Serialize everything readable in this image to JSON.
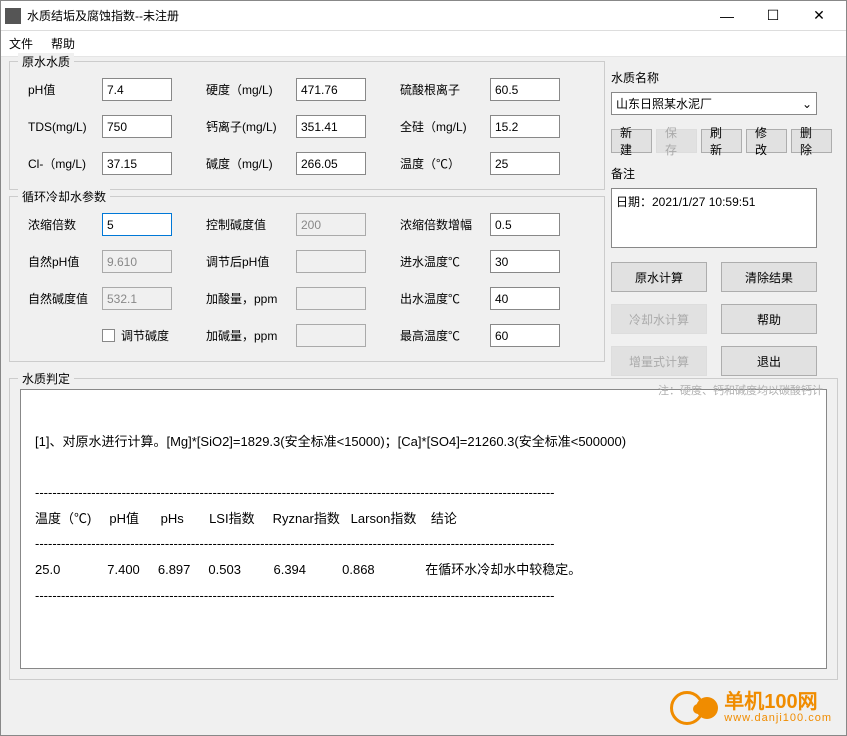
{
  "window": {
    "title": "水质结垢及腐蚀指数--未注册"
  },
  "menu": {
    "file": "文件",
    "help": "帮助"
  },
  "raw": {
    "legend": "原水水质",
    "ph_label": "pH值",
    "ph": "7.4",
    "hardness_label": "硬度（mg/L)",
    "hardness": "471.76",
    "sulfate_label": "硫酸根离子",
    "sulfate": "60.5",
    "tds_label": "TDS(mg/L)",
    "tds": "750",
    "ca_label": "钙离子(mg/L)",
    "ca": "351.41",
    "si_label": "全硅（mg/L)",
    "si": "15.2",
    "cl_label": "Cl-（mg/L)",
    "cl": "37.15",
    "alk_label": "碱度（mg/L)",
    "alk": "266.05",
    "temp_label": "温度（℃）",
    "temp": "25"
  },
  "cool": {
    "legend": "循环冷却水参数",
    "conc_label": "浓缩倍数",
    "conc": "5",
    "ctrlalk_label": "控制碱度值",
    "ctrlalk": "200",
    "concinc_label": "浓缩倍数增幅",
    "concinc": "0.5",
    "natph_label": "自然pH值",
    "natph": "9.610",
    "adjph_label": "调节后pH值",
    "adjph": "",
    "tin_label": "进水温度℃",
    "tin": "30",
    "natalk_label": "自然碱度值",
    "natalk": "532.1",
    "acid_label": "加酸量，ppm",
    "acid": "",
    "tout_label": "出水温度℃",
    "tout": "40",
    "adjalk_label": "调节碱度",
    "base_label": "加碱量，ppm",
    "base": "",
    "tmax_label": "最高温度℃",
    "tmax": "60"
  },
  "right": {
    "name_label": "水质名称",
    "name_value": "山东日照某水泥厂",
    "btn_new": "新建",
    "btn_save": "保存",
    "btn_refresh": "刷新",
    "btn_edit": "修改",
    "btn_delete": "删除",
    "remark_label": "备注",
    "remark_text": "日期：2021/1/27 10:59:51",
    "btn_rawcalc": "原水计算",
    "btn_clear": "清除结果",
    "btn_coolcalc": "冷却水计算",
    "btn_help": "帮助",
    "btn_inccalc": "增量式计算",
    "btn_exit": "退出"
  },
  "result": {
    "legend": "水质判定",
    "note": "注：硬度、钙和碱度均以碳酸钙计",
    "line1": "[1]、对原水进行计算。[Mg]*[SiO2]=1829.3(安全标准<15000)；[Ca]*[SO4]=21260.3(安全标准<500000)",
    "hr": "------------------------------------------------------------------------------------------------------------------------",
    "header": "温度（℃)     pH值      pHs       LSI指数     Ryznar指数   Larson指数    结论",
    "row1": "25.0             7.400     6.897     0.503         6.394          0.868              在循环水冷却水中较稳定。"
  },
  "watermark": {
    "text": "单机100网",
    "sub": "www.danji100.com"
  }
}
